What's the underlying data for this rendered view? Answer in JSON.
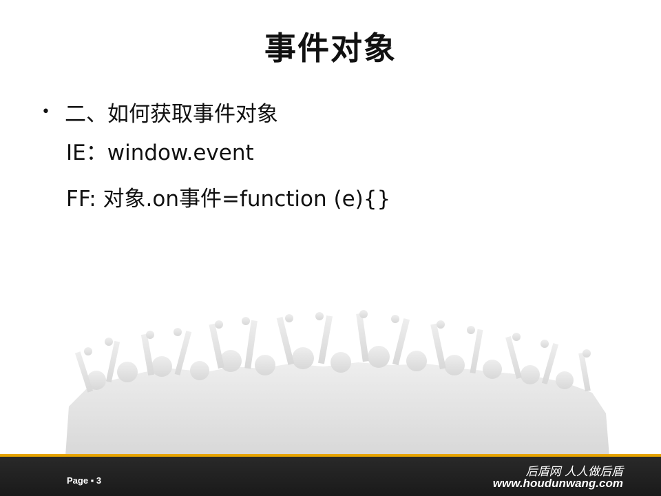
{
  "slide": {
    "title": "事件对象",
    "bullet_marker": "•",
    "bullet_text": "二、如何获取事件对象",
    "lines": [
      "IE：window.event",
      "FF:  对象.on事件=function (e){}"
    ]
  },
  "footer": {
    "page_label": "Page ▪ 3",
    "brand_cn": "后盾网 人人做后盾",
    "brand_url": "www.houdunwang.com"
  },
  "colors": {
    "footer_bg": "#222222",
    "accent_stripe": "#e6a400",
    "crowd": "#e2e2e2"
  }
}
